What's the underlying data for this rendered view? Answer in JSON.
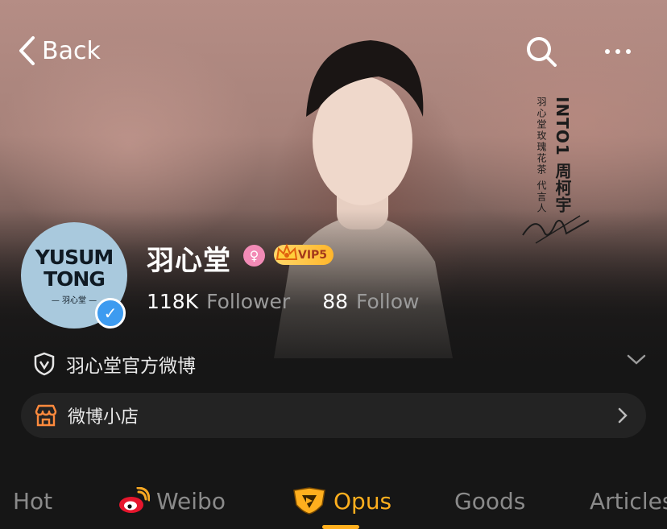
{
  "nav": {
    "back_label": "Back"
  },
  "cover": {
    "vertical_title": "INTO1 周柯宇",
    "vertical_subtitle": "羽心堂玫瑰花茶 代言人"
  },
  "profile": {
    "avatar_line1": "YUSUM",
    "avatar_line2": "TONG",
    "avatar_line3": "— 羽心堂 —",
    "name": "羽心堂",
    "gender_symbol": "♀",
    "vip_label": "VIP5",
    "followers_count": "118K",
    "followers_label": "Follower",
    "following_count": "88",
    "following_label": "Follow",
    "verification_text": "羽心堂官方微博",
    "shop_label": "微博小店"
  },
  "tabs": [
    {
      "label": "Hot"
    },
    {
      "label": "Weibo"
    },
    {
      "label": "Opus"
    },
    {
      "label": "Goods"
    },
    {
      "label": "Articles"
    }
  ],
  "colors": {
    "accent": "#ffaf1e",
    "verified_blue": "#3d9bf0",
    "gender_pink": "#f28bb6",
    "background": "#161616"
  }
}
